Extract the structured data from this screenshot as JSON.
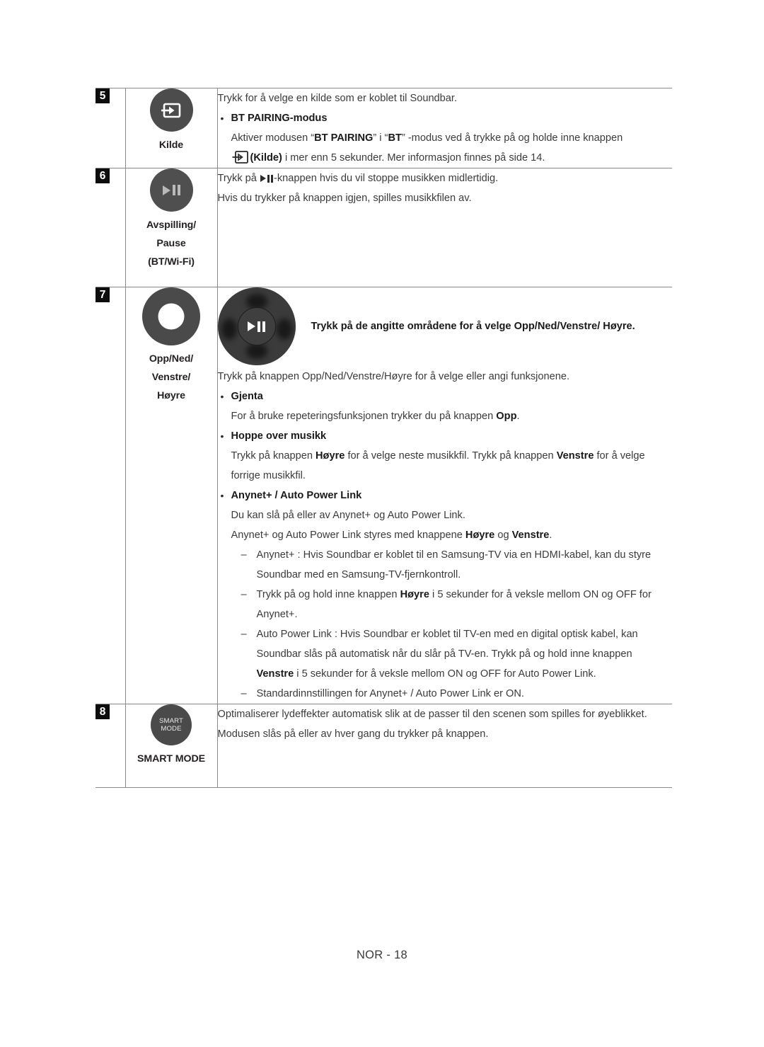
{
  "footer": {
    "page_label": "NOR - 18"
  },
  "colors": {
    "button_fill": "#4a4a4a",
    "dpad_fill": "#3b3b3b",
    "badge_bg": "#0d0d0d",
    "rule": "#8a8a8a",
    "text": "#3b3b3b",
    "text_bold": "#1a1a1a"
  },
  "table": {
    "rows": [
      {
        "number": "5",
        "icon": "source-input-icon",
        "caption": [
          "Kilde"
        ],
        "desc": {
          "lead": "Trykk for å velge en kilde som er koblet til Soundbar.",
          "bullets": [
            {
              "heading": "BT PAIRING-modus",
              "lines": [
                "Aktiver modusen “BT PAIRING” i “BT” -modus ved å trykke på og holde inne knappen",
                "(Kilde) i mer enn 5 sekunder. Mer informasjon finnes på side 14."
              ],
              "bold_fragments": [
                "BT PAIRING",
                "BT",
                "(Kilde)"
              ]
            }
          ]
        }
      },
      {
        "number": "6",
        "icon": "play-pause-icon",
        "caption": [
          "Avspilling/",
          "Pause",
          "(BT/Wi-Fi)"
        ],
        "desc": {
          "lead": "Trykk på ▶II-knappen hvis du vil stoppe musikken midlertidig.",
          "lead2": "Hvis du trykker på knappen igjen, spilles musikkfilen av."
        }
      },
      {
        "number": "7",
        "icon": "ring-dpad-icon",
        "caption": [
          "Opp/Ned/",
          "Venstre/",
          "Høyre"
        ],
        "desc": {
          "dpad_heading": "Trykk på de angitte områdene for å velge Opp/Ned/Venstre/ Høyre.",
          "lead": "Trykk på knappen Opp/Ned/Venstre/Høyre for å velge eller angi funksjonene.",
          "bullets": [
            {
              "heading": "Gjenta",
              "lines": [
                "For å bruke repeteringsfunksjonen trykker du på knappen Opp."
              ],
              "bold_fragments": [
                "Opp"
              ]
            },
            {
              "heading": "Hoppe over musikk",
              "lines": [
                "Trykk på knappen Høyre for å velge neste musikkfil. Trykk på knappen Venstre for å velge forrige musikkfil."
              ],
              "bold_fragments": [
                "Høyre",
                "Venstre"
              ]
            },
            {
              "heading": "Anynet+ / Auto Power Link",
              "lines": [
                "Du kan slå på eller av Anynet+ og Auto Power Link.",
                "Anynet+ og Auto Power Link styres med knappene Høyre og Venstre."
              ],
              "bold_fragments": [
                "Høyre",
                "Venstre"
              ],
              "dashes": [
                "Anynet+ : Hvis Soundbar er koblet til en Samsung-TV via en HDMI-kabel, kan du styre Soundbar med en Samsung-TV-fjernkontroll.",
                "Trykk på og hold inne knappen Høyre i 5 sekunder for å veksle mellom ON og OFF for Anynet+.",
                "Auto Power Link : Hvis Soundbar er koblet til TV-en med en digital optisk kabel, kan Soundbar slås på automatisk når du slår på TV-en. Trykk på og hold inne knappen Venstre i 5 sekunder for å veksle mellom ON og OFF for Auto Power Link.",
                "Standardinnstillingen for Anynet+ / Auto Power Link er ON."
              ]
            }
          ]
        }
      },
      {
        "number": "8",
        "icon": "smart-mode-icon",
        "icon_text": [
          "SMART",
          "MODE"
        ],
        "caption": [
          "SMART MODE"
        ],
        "desc": {
          "lead": "Optimaliserer lydeffekter automatisk slik at de passer til den scenen som spilles for øyeblikket. Modusen slås på eller av hver gang du trykker på knappen."
        }
      }
    ]
  }
}
